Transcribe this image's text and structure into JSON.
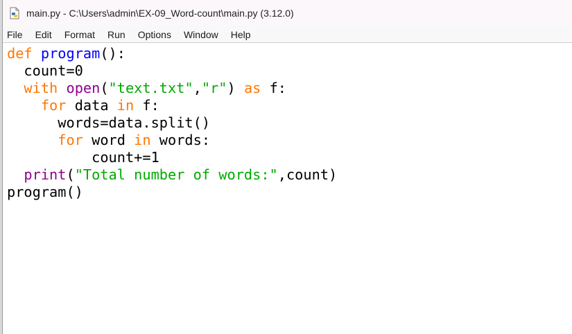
{
  "window": {
    "title": "main.py - C:\\Users\\admin\\EX-09_Word-count\\main.py (3.12.0)"
  },
  "menu": {
    "items": [
      "File",
      "Edit",
      "Format",
      "Run",
      "Options",
      "Window",
      "Help"
    ]
  },
  "editor": {
    "colors": {
      "keyword": "#ff7700",
      "definition": "#0000ff",
      "builtin": "#900090",
      "string": "#00aa00",
      "default": "#000000"
    },
    "lines": [
      {
        "indent": "",
        "tokens": [
          {
            "t": "def",
            "c": "kw"
          },
          {
            "t": " ",
            "c": ""
          },
          {
            "t": "program",
            "c": "def"
          },
          {
            "t": "():",
            "c": ""
          }
        ]
      },
      {
        "indent": "  ",
        "tokens": [
          {
            "t": "count=0",
            "c": ""
          }
        ]
      },
      {
        "indent": "  ",
        "tokens": [
          {
            "t": "with",
            "c": "kw"
          },
          {
            "t": " ",
            "c": ""
          },
          {
            "t": "open",
            "c": "bi"
          },
          {
            "t": "(",
            "c": ""
          },
          {
            "t": "\"text.txt\"",
            "c": "str"
          },
          {
            "t": ",",
            "c": ""
          },
          {
            "t": "\"r\"",
            "c": "str"
          },
          {
            "t": ") ",
            "c": ""
          },
          {
            "t": "as",
            "c": "kw"
          },
          {
            "t": " f:",
            "c": ""
          }
        ]
      },
      {
        "indent": "    ",
        "tokens": [
          {
            "t": "for",
            "c": "kw"
          },
          {
            "t": " data ",
            "c": ""
          },
          {
            "t": "in",
            "c": "kw"
          },
          {
            "t": " f:",
            "c": ""
          }
        ]
      },
      {
        "indent": "      ",
        "tokens": [
          {
            "t": "words=data.split()",
            "c": ""
          }
        ]
      },
      {
        "indent": "      ",
        "tokens": [
          {
            "t": "for",
            "c": "kw"
          },
          {
            "t": " word ",
            "c": ""
          },
          {
            "t": "in",
            "c": "kw"
          },
          {
            "t": " words:",
            "c": ""
          }
        ]
      },
      {
        "indent": "          ",
        "tokens": [
          {
            "t": "count+=1",
            "c": ""
          }
        ]
      },
      {
        "indent": "  ",
        "tokens": [
          {
            "t": "print",
            "c": "bi"
          },
          {
            "t": "(",
            "c": ""
          },
          {
            "t": "\"Total number of words:\"",
            "c": "str"
          },
          {
            "t": ",count)",
            "c": ""
          }
        ]
      },
      {
        "indent": "",
        "tokens": [
          {
            "t": "program()",
            "c": ""
          }
        ]
      }
    ]
  }
}
